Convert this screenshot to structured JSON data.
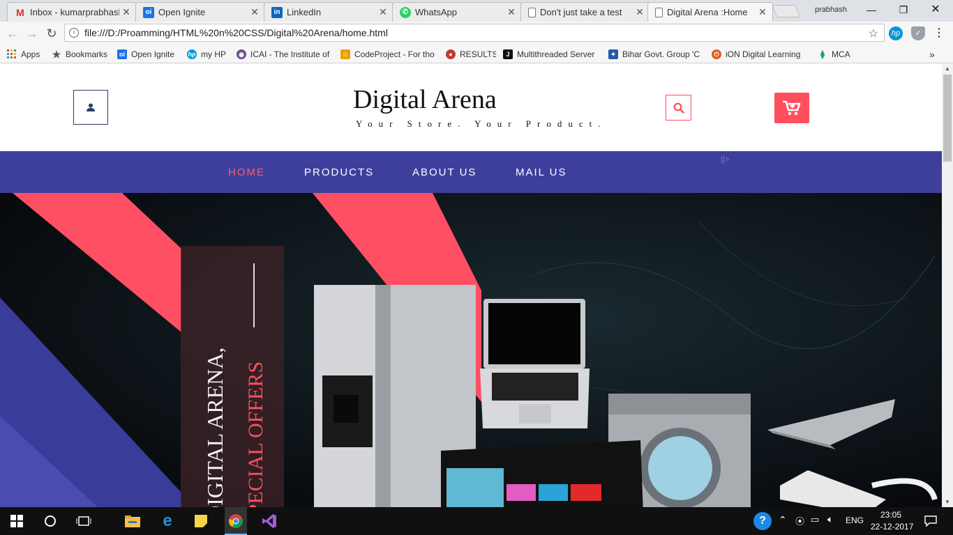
{
  "browser": {
    "tabs": [
      {
        "title": "Inbox - kumarprabhash",
        "icon": "gmail-icon",
        "color": "#d93025",
        "glyph": "M"
      },
      {
        "title": "Open Ignite",
        "icon": "open-ignite-icon",
        "color": "#1a73e8",
        "glyph": "oi"
      },
      {
        "title": "LinkedIn",
        "icon": "linkedin-icon",
        "color": "#0a66c2",
        "glyph": "in"
      },
      {
        "title": "WhatsApp",
        "icon": "whatsapp-icon",
        "color": "#25d366",
        "glyph": "✆"
      },
      {
        "title": "Don't just take a test",
        "icon": "document-icon",
        "color": "#777777",
        "glyph": "▯"
      },
      {
        "title": "Digital Arena :Home",
        "icon": "document-icon",
        "color": "#777777",
        "glyph": "▯"
      }
    ],
    "profile_name": "prabhash",
    "url": "file:///D:/Proamming/HTML%20n%20CSS/Digital%20Arena/home.html",
    "bookmarks": [
      {
        "label": "Apps",
        "icon": "apps-grid-icon",
        "color": "#e94235"
      },
      {
        "label": "Bookmarks",
        "icon": "star-icon",
        "color": "#555555"
      },
      {
        "label": "Open Ignite",
        "icon": "open-ignite-icon",
        "color": "#1a73e8"
      },
      {
        "label": "my HP",
        "icon": "hp-icon",
        "color": "#0096d6"
      },
      {
        "label": "ICAI - The Institute of",
        "icon": "icai-icon",
        "color": "#6b4c8a"
      },
      {
        "label": "CodeProject - For tho",
        "icon": "codeproject-icon",
        "color": "#e8a100"
      },
      {
        "label": "RESULTS",
        "icon": "results-icon",
        "color": "#c0392b"
      },
      {
        "label": "Multithreaded Server",
        "icon": "j-icon",
        "color": "#111111"
      },
      {
        "label": "Bihar Govt. Group 'C",
        "icon": "bihar-icon",
        "color": "#1f5aa6"
      },
      {
        "label": "iON Digital Learning",
        "icon": "ion-icon",
        "color": "#e25c1b"
      },
      {
        "label": "MCA",
        "icon": "mca-icon",
        "color": "#19a37b"
      }
    ]
  },
  "site": {
    "brand": "Digital Arena",
    "tagline": "Your Store. Your Product.",
    "stray_text": "||>",
    "nav": [
      "HOME",
      "PRODUCTS",
      "ABOUT US",
      "MAIL US"
    ],
    "hero": {
      "line1": "DIGITAL ARENA,",
      "line2": "SPECIAL OFFERS"
    },
    "colors": {
      "accent": "#ff4f5e",
      "nav_bg": "#3e3f9d"
    }
  },
  "taskbar": {
    "language": "ENG",
    "time": "23:05",
    "date": "22-12-2017"
  }
}
